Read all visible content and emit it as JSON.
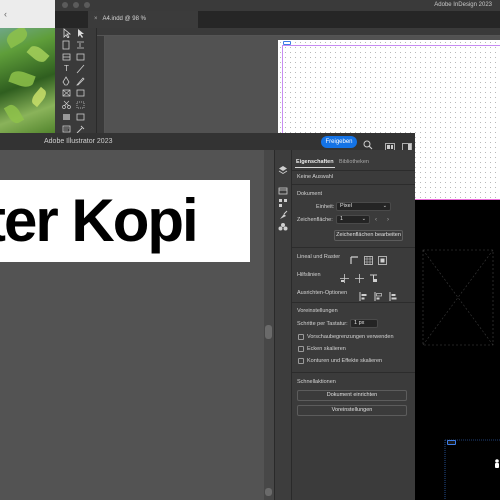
{
  "indesign": {
    "app_title": "Adobe InDesign 2023",
    "tab_label": "A4.indd @ 98 %",
    "tab_close": "×"
  },
  "illustrator": {
    "app_title": "Adobe Illustrator 2023",
    "share_button": "Freigeben",
    "artboard_text": "ter Kopi",
    "panel": {
      "tabs": [
        {
          "label": "Eigenschaften",
          "active": true
        },
        {
          "label": "Bibliotheken",
          "active": false
        }
      ],
      "no_selection": "Keine Auswahl",
      "document": {
        "heading": "Dokument",
        "unit_label": "Einheit:",
        "unit_value": "Pixel",
        "artboard_label": "Zeichenfläche:",
        "artboard_value": "1",
        "edit_artboards_button": "Zeichenflächen bearbeiten"
      },
      "rulers_grid": {
        "heading": "Lineal und Raster"
      },
      "guides": {
        "heading": "Hilfslinien"
      },
      "align": {
        "heading": "Ausrichten-Optionen"
      },
      "preferences": {
        "heading": "Voreinstellungen",
        "keyboard_increment_label": "Schritte per Tastatur:",
        "keyboard_increment_value": "1 px",
        "checkboxes": [
          {
            "label": "Vorschaubegrenzungen verwenden",
            "checked": false
          },
          {
            "label": "Ecken skalieren",
            "checked": false
          },
          {
            "label": "Konturen und Effekte skalieren",
            "checked": false
          }
        ]
      },
      "quick_actions": {
        "heading": "Schnellaktionen",
        "fit_document_button": "Dokument einrichten",
        "preferences_button": "Voreinstellungen"
      }
    }
  },
  "colors": {
    "accent_blue": "#1473e6",
    "panel_bg": "#3b3b3b",
    "canvas_bg": "#535353",
    "guide_magenta": "#c68cf2"
  }
}
